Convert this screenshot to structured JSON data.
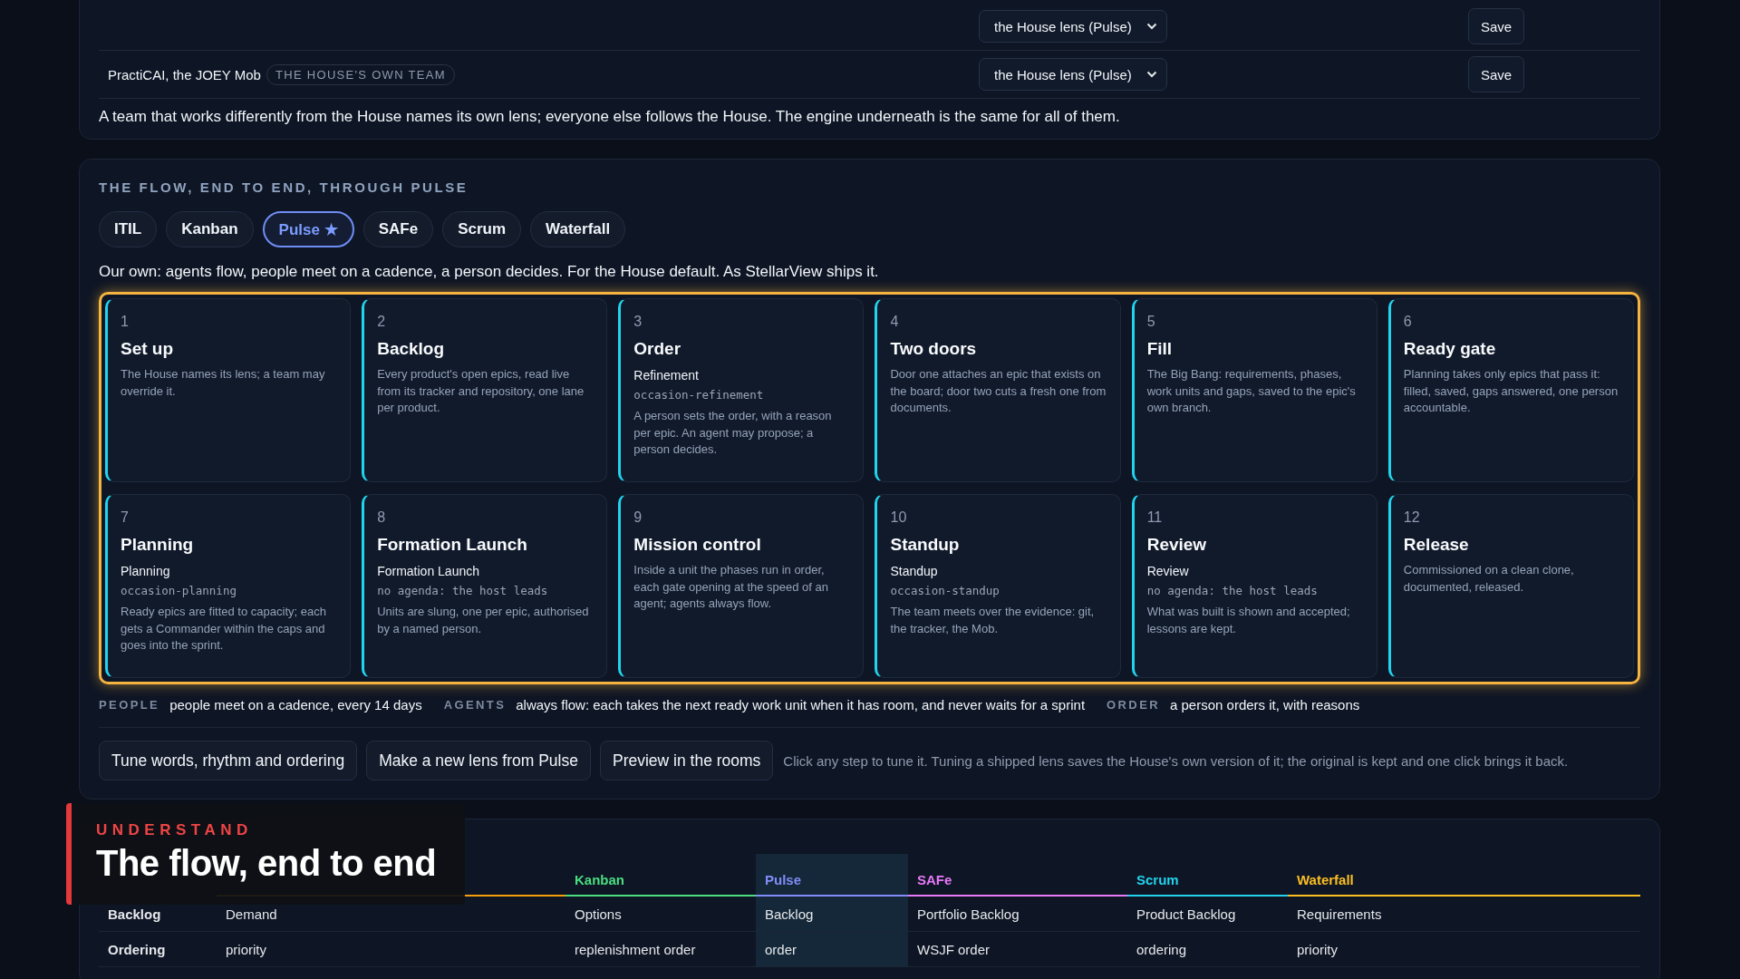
{
  "team_lenses": {
    "rows": [
      {
        "lens": "the House lens (Pulse)",
        "save": "Save"
      },
      {
        "team": "PractiCAI, the JOEY Mob",
        "badge": "THE HOUSE'S OWN TEAM",
        "lens": "the House lens (Pulse)",
        "save": "Save"
      }
    ],
    "note": "A team that works differently from the House names its own lens; everyone else follows the House. The engine underneath is the same for all of them."
  },
  "flow": {
    "heading": "THE FLOW, END TO END, THROUGH PULSE",
    "tabs": [
      {
        "label": "ITIL",
        "selected": false
      },
      {
        "label": "Kanban",
        "selected": false
      },
      {
        "label": "Pulse ★",
        "selected": true
      },
      {
        "label": "SAFe",
        "selected": false
      },
      {
        "label": "Scrum",
        "selected": false
      },
      {
        "label": "Waterfall",
        "selected": false
      }
    ],
    "description": "Our own: agents flow, people meet on a cadence, a person decides. For the House default. As StellarView ships it.",
    "steps": [
      {
        "number": "1",
        "title": "Set up",
        "desc": "The House names its lens; a team may override it."
      },
      {
        "number": "2",
        "title": "Backlog",
        "desc": "Every product's open epics, read live from its tracker and repository, one lane per product."
      },
      {
        "number": "3",
        "title": "Order",
        "subtitle": "Refinement",
        "code": "occasion-refinement",
        "desc": "A person sets the order, with a reason per epic. An agent may propose; a person decides."
      },
      {
        "number": "4",
        "title": "Two doors",
        "desc": "Door one attaches an epic that exists on the board; door two cuts a fresh one from documents."
      },
      {
        "number": "5",
        "title": "Fill",
        "desc": "The Big Bang: requirements, phases, work units and gaps, saved to the epic's own branch."
      },
      {
        "number": "6",
        "title": "Ready gate",
        "desc": "Planning takes only epics that pass it: filled, saved, gaps answered, one person accountable."
      },
      {
        "number": "7",
        "title": "Planning",
        "subtitle": "Planning",
        "code": "occasion-planning",
        "desc": "Ready epics are fitted to capacity; each gets a Commander within the caps and goes into the sprint."
      },
      {
        "number": "8",
        "title": "Formation Launch",
        "subtitle": "Formation Launch",
        "code": "no agenda: the host leads",
        "desc": "Units are slung, one per epic, authorised by a named person."
      },
      {
        "number": "9",
        "title": "Mission control",
        "desc": "Inside a unit the phases run in order, each gate opening at the speed of an agent; agents always flow."
      },
      {
        "number": "10",
        "title": "Standup",
        "subtitle": "Standup",
        "code": "occasion-standup",
        "desc": "The team meets over the evidence: git, the tracker, the Mob."
      },
      {
        "number": "11",
        "title": "Review",
        "subtitle": "Review",
        "code": "no agenda: the host leads",
        "desc": "What was built is shown and accepted; lessons are kept."
      },
      {
        "number": "12",
        "title": "Release",
        "desc": "Commissioned on a clean clone, documented, released."
      }
    ],
    "legend": [
      {
        "label": "PEOPLE",
        "text": "people meet on a cadence, every 14 days"
      },
      {
        "label": "AGENTS",
        "text": "always flow: each takes the next ready work unit when it has room, and never waits for a sprint"
      },
      {
        "label": "ORDER",
        "text": "a person orders it, with reasons"
      }
    ],
    "actions": [
      "Tune words, rhythm and ordering",
      "Make a new lens from Pulse",
      "Preview in the rooms"
    ],
    "hint": "Click any step to tune it. Tuning a shipped lens saves the House's own version of it; the original is kept and one click brings it back."
  },
  "lenses_table": {
    "columns": [
      {
        "color": "#f59e0b",
        "selected": false
      },
      {
        "label": "Kanban",
        "color": "#4ade80",
        "selected": false
      },
      {
        "label": "Pulse",
        "color": "#818cf8",
        "selected": true
      },
      {
        "label": "SAFe",
        "color": "#e879f9",
        "selected": false
      },
      {
        "label": "Scrum",
        "color": "#22d3ee",
        "selected": false
      },
      {
        "label": "Waterfall",
        "color": "#fbbf24",
        "selected": false
      }
    ],
    "rows": [
      {
        "label": "Backlog",
        "cells": [
          "Demand",
          "Options",
          "Backlog",
          "Portfolio Backlog",
          "Product Backlog",
          "Requirements"
        ]
      },
      {
        "label": "Ordering",
        "cells": [
          "priority",
          "replenishment order",
          "order",
          "WSJF order",
          "ordering",
          "priority"
        ]
      }
    ]
  },
  "caption": {
    "eyebrow": "UNDERSTAND",
    "title": "The flow, end to end"
  }
}
